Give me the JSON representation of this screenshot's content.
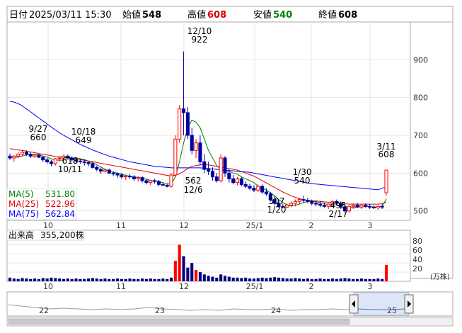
{
  "header": {
    "date_label": "日付",
    "datetime": "2025/03/11 15:30",
    "open_label": "始値",
    "open": "548",
    "high_label": "高値",
    "high": "608",
    "low_label": "安値",
    "low": "540",
    "close_label": "終値",
    "close": "608"
  },
  "colors": {
    "up": "#ff0000",
    "down": "#0000a0",
    "ma5": "#008000",
    "ma25": "#e00000",
    "ma75": "#0000ff",
    "volume": "#000080",
    "volume_up": "#ff0000",
    "overview_fill": "#dde6f7"
  },
  "legend": {
    "ma5_label": "MA(5)",
    "ma5_value": "531.80",
    "ma25_label": "MA(25)",
    "ma25_value": "522.96",
    "ma75_label": "MA(75)",
    "ma75_value": "562.84"
  },
  "volume_panel": {
    "title": "出来高",
    "value": "355,200株",
    "unit": "(万株)",
    "ticks": [
      "80",
      "60",
      "40",
      "20"
    ],
    "tick_values": [
      80,
      60,
      40,
      20
    ],
    "ylim": [
      0,
      90
    ]
  },
  "x_labels": [
    "10",
    "11",
    "12",
    "25/1",
    "2",
    "3"
  ],
  "overview": {
    "labels": [
      "22",
      "23",
      "24",
      "25"
    ],
    "left_handle_icon": "chevron-left-icon",
    "right_handle_icon": "chevron-right-icon"
  },
  "annotations": [
    {
      "key": "a1",
      "line1": "9/27",
      "line2": "660"
    },
    {
      "key": "a2",
      "line1": "10/18",
      "line2": "649"
    },
    {
      "key": "a3",
      "line1": "618",
      "line2": "10/11"
    },
    {
      "key": "a4",
      "line1": "12/10",
      "line2": "922"
    },
    {
      "key": "a5",
      "line1": "562",
      "line2": "12/6"
    },
    {
      "key": "a6",
      "line1": "1/30",
      "line2": "540"
    },
    {
      "key": "a7",
      "line1": "507",
      "line2": "1/20"
    },
    {
      "key": "a8",
      "line1": "495",
      "line2": "2/17"
    },
    {
      "key": "a9",
      "line1": "3/11",
      "line2": "608"
    }
  ],
  "chart_data": {
    "type": "candlestick",
    "title": "",
    "xlabel": "",
    "ylabel": "",
    "ylim": [
      475,
      1000
    ],
    "y_ticks": [
      500,
      600,
      700,
      800,
      900
    ],
    "grid": true,
    "legend_position": "bottom-left",
    "x_tick_labels": [
      "10",
      "11",
      "12",
      "25/1",
      "2",
      "3"
    ],
    "candles": [
      [
        645,
        652,
        635,
        640
      ],
      [
        640,
        648,
        630,
        645
      ],
      [
        645,
        655,
        640,
        650
      ],
      [
        650,
        660,
        645,
        655
      ],
      [
        655,
        660,
        645,
        650
      ],
      [
        650,
        655,
        640,
        645
      ],
      [
        645,
        650,
        640,
        648
      ],
      [
        648,
        652,
        640,
        642
      ],
      [
        642,
        646,
        630,
        635
      ],
      [
        635,
        640,
        625,
        630
      ],
      [
        630,
        635,
        618,
        625
      ],
      [
        625,
        640,
        620,
        638
      ],
      [
        638,
        645,
        630,
        640
      ],
      [
        640,
        649,
        635,
        645
      ],
      [
        645,
        649,
        638,
        640
      ],
      [
        640,
        645,
        630,
        635
      ],
      [
        635,
        640,
        628,
        632
      ],
      [
        632,
        638,
        625,
        630
      ],
      [
        630,
        635,
        620,
        628
      ],
      [
        628,
        632,
        618,
        625
      ],
      [
        625,
        630,
        612,
        615
      ],
      [
        615,
        620,
        605,
        610
      ],
      [
        610,
        615,
        598,
        605
      ],
      [
        605,
        612,
        600,
        608
      ],
      [
        608,
        612,
        598,
        600
      ],
      [
        600,
        605,
        592,
        598
      ],
      [
        598,
        602,
        588,
        595
      ],
      [
        595,
        600,
        585,
        590
      ],
      [
        590,
        596,
        582,
        592
      ],
      [
        592,
        598,
        585,
        590
      ],
      [
        590,
        595,
        580,
        585
      ],
      [
        585,
        592,
        578,
        588
      ],
      [
        588,
        592,
        575,
        580
      ],
      [
        580,
        585,
        570,
        575
      ],
      [
        575,
        582,
        568,
        580
      ],
      [
        580,
        585,
        572,
        578
      ],
      [
        578,
        582,
        565,
        570
      ],
      [
        570,
        575,
        565,
        568
      ],
      [
        568,
        572,
        562,
        565
      ],
      [
        565,
        600,
        562,
        595
      ],
      [
        595,
        700,
        590,
        690
      ],
      [
        690,
        780,
        680,
        770
      ],
      [
        770,
        922,
        700,
        760
      ],
      [
        760,
        775,
        690,
        700
      ],
      [
        700,
        720,
        650,
        660
      ],
      [
        660,
        690,
        640,
        680
      ],
      [
        680,
        700,
        620,
        630
      ],
      [
        630,
        650,
        600,
        610
      ],
      [
        610,
        630,
        595,
        605
      ],
      [
        605,
        615,
        580,
        590
      ],
      [
        590,
        600,
        575,
        580
      ],
      [
        580,
        650,
        575,
        640
      ],
      [
        640,
        645,
        590,
        600
      ],
      [
        600,
        610,
        575,
        585
      ],
      [
        585,
        595,
        570,
        575
      ],
      [
        575,
        590,
        568,
        585
      ],
      [
        585,
        590,
        565,
        570
      ],
      [
        570,
        578,
        560,
        565
      ],
      [
        565,
        572,
        555,
        560
      ],
      [
        560,
        568,
        550,
        555
      ],
      [
        555,
        570,
        550,
        565
      ],
      [
        565,
        570,
        545,
        550
      ],
      [
        550,
        560,
        540,
        545
      ],
      [
        545,
        550,
        525,
        530
      ],
      [
        530,
        540,
        515,
        520
      ],
      [
        520,
        528,
        508,
        512
      ],
      [
        512,
        518,
        507,
        510
      ],
      [
        510,
        520,
        508,
        515
      ],
      [
        515,
        525,
        510,
        520
      ],
      [
        520,
        530,
        512,
        525
      ],
      [
        525,
        535,
        518,
        530
      ],
      [
        530,
        540,
        522,
        528
      ],
      [
        528,
        535,
        520,
        525
      ],
      [
        525,
        530,
        515,
        520
      ],
      [
        520,
        528,
        512,
        518
      ],
      [
        518,
        525,
        510,
        515
      ],
      [
        515,
        522,
        508,
        512
      ],
      [
        512,
        520,
        505,
        518
      ],
      [
        518,
        528,
        512,
        525
      ],
      [
        525,
        530,
        515,
        520
      ],
      [
        520,
        525,
        505,
        510
      ],
      [
        510,
        518,
        495,
        500
      ],
      [
        500,
        515,
        495,
        512
      ],
      [
        512,
        520,
        505,
        515
      ],
      [
        515,
        522,
        508,
        510
      ],
      [
        510,
        518,
        505,
        515
      ],
      [
        515,
        520,
        508,
        512
      ],
      [
        512,
        518,
        505,
        510
      ],
      [
        510,
        515,
        505,
        508
      ],
      [
        508,
        515,
        503,
        512
      ],
      [
        512,
        518,
        505,
        510
      ],
      [
        548,
        608,
        540,
        608
      ]
    ],
    "series": [
      {
        "name": "MA(5)",
        "values": [
          640,
          641,
          643,
          645,
          648,
          650,
          650,
          648,
          645,
          642,
          638,
          635,
          634,
          635,
          637,
          639,
          640,
          638,
          636,
          632,
          628,
          622,
          616,
          610,
          606,
          602,
          600,
          597,
          594,
          592,
          590,
          589,
          587,
          584,
          581,
          579,
          577,
          575,
          572,
          570,
          590,
          630,
          680,
          720,
          740,
          735,
          720,
          690,
          660,
          640,
          620,
          610,
          605,
          605,
          600,
          597,
          590,
          585,
          580,
          575,
          565,
          560,
          555,
          548,
          540,
          530,
          522,
          516,
          513,
          515,
          518,
          522,
          525,
          526,
          524,
          522,
          519,
          517,
          516,
          516,
          515,
          512,
          510,
          509,
          510,
          512,
          512,
          511,
          510,
          511,
          512,
          532
        ]
      },
      {
        "name": "MA(25)",
        "values": [
          665,
          663,
          661,
          660,
          658,
          656,
          654,
          652,
          650,
          648,
          646,
          644,
          643,
          642,
          641,
          640,
          638,
          636,
          634,
          632,
          630,
          628,
          626,
          624,
          622,
          620,
          618,
          616,
          614,
          612,
          610,
          608,
          606,
          604,
          602,
          600,
          598,
          596,
          594,
          592,
          594,
          598,
          605,
          612,
          618,
          620,
          622,
          622,
          622,
          620,
          618,
          616,
          614,
          612,
          610,
          608,
          604,
          600,
          596,
          592,
          586,
          580,
          574,
          568,
          562,
          556,
          550,
          545,
          540,
          536,
          532,
          530,
          528,
          527,
          526,
          525,
          524,
          523,
          522,
          521,
          520,
          519,
          518,
          518,
          518,
          518,
          518,
          518,
          518,
          518,
          519,
          523
        ]
      },
      {
        "name": "MA(75)",
        "values": [
          790,
          788,
          784,
          778,
          770,
          762,
          754,
          746,
          738,
          730,
          722,
          714,
          707,
          700,
          694,
          688,
          682,
          676,
          671,
          666,
          661,
          657,
          653,
          649,
          645,
          642,
          639,
          636,
          633,
          630,
          628,
          626,
          624,
          622,
          620,
          618,
          617,
          616,
          615,
          614,
          614,
          614,
          614,
          614,
          614,
          614,
          614,
          613,
          612,
          611,
          610,
          609,
          608,
          607,
          606,
          605,
          604,
          603,
          602,
          600,
          598,
          596,
          594,
          592,
          590,
          588,
          586,
          584,
          582,
          580,
          578,
          576,
          574,
          572,
          571,
          570,
          569,
          568,
          567,
          566,
          565,
          564,
          563,
          562,
          561,
          560,
          559,
          558,
          557,
          556,
          560,
          563
        ]
      }
    ],
    "volume": [
      8,
      6,
      5,
      7,
      6,
      5,
      6,
      5,
      7,
      6,
      8,
      7,
      6,
      5,
      6,
      5,
      6,
      5,
      5,
      6,
      7,
      6,
      5,
      6,
      5,
      5,
      6,
      5,
      5,
      6,
      5,
      5,
      6,
      5,
      6,
      5,
      5,
      6,
      5,
      8,
      45,
      80,
      55,
      30,
      40,
      25,
      20,
      15,
      12,
      10,
      8,
      15,
      12,
      10,
      8,
      8,
      7,
      8,
      6,
      6,
      7,
      8,
      7,
      8,
      9,
      8,
      7,
      6,
      6,
      7,
      6,
      5,
      6,
      5,
      5,
      6,
      5,
      5,
      6,
      5,
      6,
      7,
      6,
      5,
      5,
      6,
      5,
      5,
      5,
      6,
      5,
      36
    ],
    "volume_unit": "万株"
  }
}
